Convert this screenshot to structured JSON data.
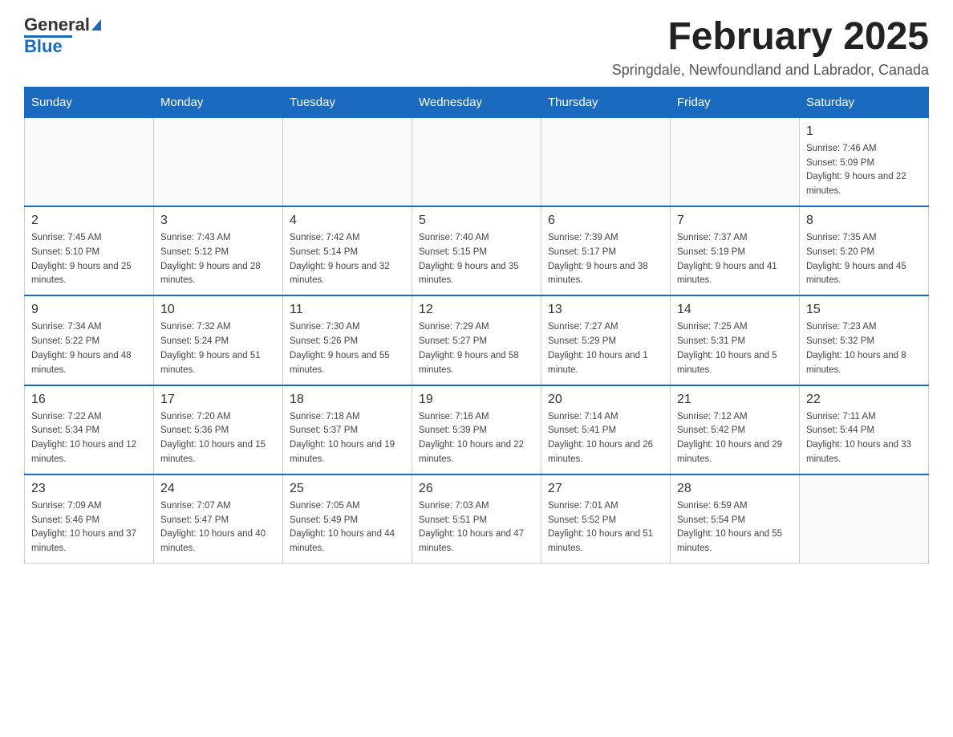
{
  "logo": {
    "text_general": "General",
    "text_blue": "Blue"
  },
  "header": {
    "month_title": "February 2025",
    "subtitle": "Springdale, Newfoundland and Labrador, Canada"
  },
  "weekdays": [
    "Sunday",
    "Monday",
    "Tuesday",
    "Wednesday",
    "Thursday",
    "Friday",
    "Saturday"
  ],
  "weeks": [
    [
      {
        "day": "",
        "info": ""
      },
      {
        "day": "",
        "info": ""
      },
      {
        "day": "",
        "info": ""
      },
      {
        "day": "",
        "info": ""
      },
      {
        "day": "",
        "info": ""
      },
      {
        "day": "",
        "info": ""
      },
      {
        "day": "1",
        "info": "Sunrise: 7:46 AM\nSunset: 5:09 PM\nDaylight: 9 hours and 22 minutes."
      }
    ],
    [
      {
        "day": "2",
        "info": "Sunrise: 7:45 AM\nSunset: 5:10 PM\nDaylight: 9 hours and 25 minutes."
      },
      {
        "day": "3",
        "info": "Sunrise: 7:43 AM\nSunset: 5:12 PM\nDaylight: 9 hours and 28 minutes."
      },
      {
        "day": "4",
        "info": "Sunrise: 7:42 AM\nSunset: 5:14 PM\nDaylight: 9 hours and 32 minutes."
      },
      {
        "day": "5",
        "info": "Sunrise: 7:40 AM\nSunset: 5:15 PM\nDaylight: 9 hours and 35 minutes."
      },
      {
        "day": "6",
        "info": "Sunrise: 7:39 AM\nSunset: 5:17 PM\nDaylight: 9 hours and 38 minutes."
      },
      {
        "day": "7",
        "info": "Sunrise: 7:37 AM\nSunset: 5:19 PM\nDaylight: 9 hours and 41 minutes."
      },
      {
        "day": "8",
        "info": "Sunrise: 7:35 AM\nSunset: 5:20 PM\nDaylight: 9 hours and 45 minutes."
      }
    ],
    [
      {
        "day": "9",
        "info": "Sunrise: 7:34 AM\nSunset: 5:22 PM\nDaylight: 9 hours and 48 minutes."
      },
      {
        "day": "10",
        "info": "Sunrise: 7:32 AM\nSunset: 5:24 PM\nDaylight: 9 hours and 51 minutes."
      },
      {
        "day": "11",
        "info": "Sunrise: 7:30 AM\nSunset: 5:26 PM\nDaylight: 9 hours and 55 minutes."
      },
      {
        "day": "12",
        "info": "Sunrise: 7:29 AM\nSunset: 5:27 PM\nDaylight: 9 hours and 58 minutes."
      },
      {
        "day": "13",
        "info": "Sunrise: 7:27 AM\nSunset: 5:29 PM\nDaylight: 10 hours and 1 minute."
      },
      {
        "day": "14",
        "info": "Sunrise: 7:25 AM\nSunset: 5:31 PM\nDaylight: 10 hours and 5 minutes."
      },
      {
        "day": "15",
        "info": "Sunrise: 7:23 AM\nSunset: 5:32 PM\nDaylight: 10 hours and 8 minutes."
      }
    ],
    [
      {
        "day": "16",
        "info": "Sunrise: 7:22 AM\nSunset: 5:34 PM\nDaylight: 10 hours and 12 minutes."
      },
      {
        "day": "17",
        "info": "Sunrise: 7:20 AM\nSunset: 5:36 PM\nDaylight: 10 hours and 15 minutes."
      },
      {
        "day": "18",
        "info": "Sunrise: 7:18 AM\nSunset: 5:37 PM\nDaylight: 10 hours and 19 minutes."
      },
      {
        "day": "19",
        "info": "Sunrise: 7:16 AM\nSunset: 5:39 PM\nDaylight: 10 hours and 22 minutes."
      },
      {
        "day": "20",
        "info": "Sunrise: 7:14 AM\nSunset: 5:41 PM\nDaylight: 10 hours and 26 minutes."
      },
      {
        "day": "21",
        "info": "Sunrise: 7:12 AM\nSunset: 5:42 PM\nDaylight: 10 hours and 29 minutes."
      },
      {
        "day": "22",
        "info": "Sunrise: 7:11 AM\nSunset: 5:44 PM\nDaylight: 10 hours and 33 minutes."
      }
    ],
    [
      {
        "day": "23",
        "info": "Sunrise: 7:09 AM\nSunset: 5:46 PM\nDaylight: 10 hours and 37 minutes."
      },
      {
        "day": "24",
        "info": "Sunrise: 7:07 AM\nSunset: 5:47 PM\nDaylight: 10 hours and 40 minutes."
      },
      {
        "day": "25",
        "info": "Sunrise: 7:05 AM\nSunset: 5:49 PM\nDaylight: 10 hours and 44 minutes."
      },
      {
        "day": "26",
        "info": "Sunrise: 7:03 AM\nSunset: 5:51 PM\nDaylight: 10 hours and 47 minutes."
      },
      {
        "day": "27",
        "info": "Sunrise: 7:01 AM\nSunset: 5:52 PM\nDaylight: 10 hours and 51 minutes."
      },
      {
        "day": "28",
        "info": "Sunrise: 6:59 AM\nSunset: 5:54 PM\nDaylight: 10 hours and 55 minutes."
      },
      {
        "day": "",
        "info": ""
      }
    ]
  ]
}
